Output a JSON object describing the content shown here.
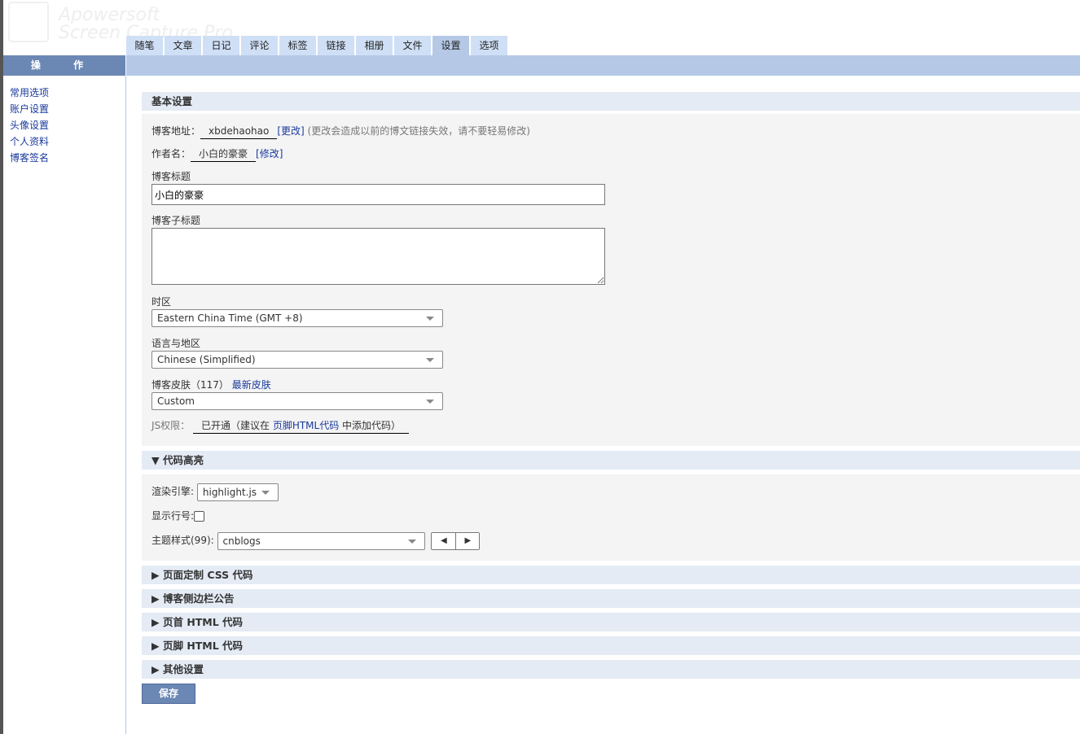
{
  "watermark": {
    "line1": "Apowersoft",
    "line2": "Screen Capture Pro"
  },
  "tabs": [
    "随笔",
    "文章",
    "日记",
    "评论",
    "标签",
    "链接",
    "相册",
    "文件",
    "设置",
    "选项"
  ],
  "active_tab": "设置",
  "sidebar": {
    "title": "操 作",
    "items": [
      "常用选项",
      "账户设置",
      "头像设置",
      "个人资料",
      "博客签名"
    ]
  },
  "basic": {
    "title": "基本设置",
    "blog_address_label": "博客地址：",
    "blog_address": "xbdehaohao",
    "change_link": "[更改]",
    "change_hint": "(更改会造成以前的博文链接失效，请不要轻易修改)",
    "author_label": "作者名：",
    "author": "小白的豪豪",
    "modify_link": "[修改]",
    "blog_title_label": "博客标题",
    "blog_title": "小白的豪豪",
    "subtitle_label": "博客子标题",
    "subtitle": "",
    "timezone_label": "时区",
    "timezone": "Eastern China Time (GMT +8)",
    "language_label": "语言与地区",
    "language": "Chinese (Simplified)",
    "skin_label": "博客皮肤（117）",
    "latest_skin_link": "最新皮肤",
    "skin": "Custom",
    "js_label": "JS权限：",
    "js_status": "已开通（建议在 ",
    "js_link": "页脚HTML代码",
    "js_tail": " 中添加代码）"
  },
  "code": {
    "title": "▼ 代码高亮",
    "engine_label": "渲染引擎:",
    "engine": "highlight.js",
    "line_numbers_label": "显示行号:",
    "line_numbers": false,
    "theme_label": "主题样式(99):",
    "theme": "cnblogs"
  },
  "collapsed": [
    "▶ 页面定制 CSS 代码",
    "▶ 博客侧边栏公告",
    "▶ 页首 HTML 代码",
    "▶ 页脚 HTML 代码",
    "▶ 其他设置"
  ],
  "save_label": "保存"
}
